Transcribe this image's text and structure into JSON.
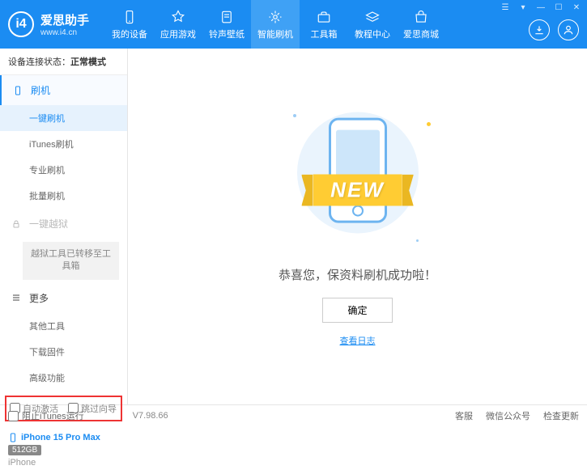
{
  "header": {
    "logo_title": "爱思助手",
    "logo_sub": "www.i4.cn",
    "nav": [
      {
        "label": "我的设备"
      },
      {
        "label": "应用游戏"
      },
      {
        "label": "铃声壁纸"
      },
      {
        "label": "智能刷机"
      },
      {
        "label": "工具箱"
      },
      {
        "label": "教程中心"
      },
      {
        "label": "爱思商城"
      }
    ]
  },
  "sidebar": {
    "status_label": "设备连接状态：",
    "status_value": "正常模式",
    "sec_flash": "刷机",
    "items_flash": [
      "一键刷机",
      "iTunes刷机",
      "专业刷机",
      "批量刷机"
    ],
    "sec_jailbreak": "一键越狱",
    "jailbreak_note": "越狱工具已转移至工具箱",
    "sec_more": "更多",
    "items_more": [
      "其他工具",
      "下载固件",
      "高级功能"
    ],
    "chk_auto": "自动激活",
    "chk_skip": "跳过向导",
    "device_name": "iPhone 15 Pro Max",
    "device_storage": "512GB",
    "device_type": "iPhone"
  },
  "main": {
    "ribbon": "NEW",
    "success_text": "恭喜您，保资料刷机成功啦！",
    "confirm_btn": "确定",
    "log_link": "查看日志"
  },
  "footer": {
    "block_itunes": "阻止iTunes运行",
    "version": "V7.98.66",
    "links": [
      "客服",
      "微信公众号",
      "检查更新"
    ]
  }
}
